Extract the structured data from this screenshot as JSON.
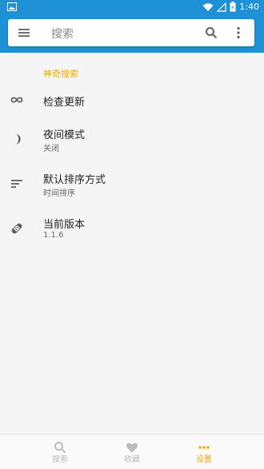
{
  "status_bar": {
    "time": "1:40"
  },
  "search": {
    "placeholder": "搜索"
  },
  "settings": {
    "section_title": "神奇搜索",
    "items": [
      {
        "title": "检查更新",
        "subtitle": ""
      },
      {
        "title": "夜间模式",
        "subtitle": "关闭"
      },
      {
        "title": "默认排序方式",
        "subtitle": "时间排序"
      },
      {
        "title": "当前版本",
        "subtitle": "1.1.6"
      }
    ]
  },
  "bottom_nav": {
    "tabs": [
      {
        "label": "搜索",
        "icon": "search-icon"
      },
      {
        "label": "收藏",
        "icon": "heart-icon"
      },
      {
        "label": "设置",
        "icon": "more-horizontal-icon"
      }
    ],
    "active": "设置"
  },
  "colors": {
    "primary": "#1e90d6",
    "accent": "#f2a800"
  }
}
